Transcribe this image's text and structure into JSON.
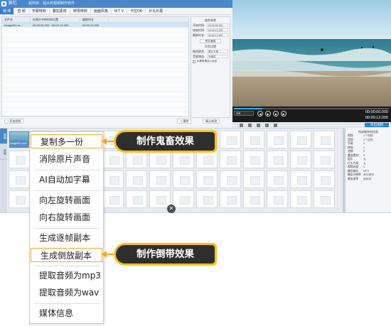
{
  "app": {
    "name": "影忆",
    "slogan": "超简单、强大的视频制作软件"
  },
  "menu": {
    "items": [
      "视 频",
      "音 频",
      "字幕特效",
      "叠加素材",
      "转场特效",
      "画面风格",
      "M T V",
      "卡拉OK",
      "片头片尾"
    ],
    "active_index": 0
  },
  "file_list": {
    "columns": [
      "文件名",
      "在原片中的时间位置",
      "截取时长"
    ],
    "rows": [
      [
        "image001.m...",
        "00:00:00.000 - 00:00:12.000",
        "00:00:12.000"
      ]
    ],
    "add_button": "添加视频",
    "delete_button": "删除",
    "confirm_button": "确认修改"
  },
  "settings": {
    "section1_title": "裁剪参数",
    "section2_title": "声音设置",
    "fields": [
      {
        "label": "开始时间:",
        "value": "00:00:00.000"
      },
      {
        "label": "结束时间:",
        "value": "00:00:12.000"
      },
      {
        "label": "截取时长:",
        "value": "00:00:12.000"
      }
    ],
    "pick_button": "预览/截取",
    "sound_fields": [
      {
        "label": "使用原音:",
        "value": "原片无损"
      },
      {
        "label": "音量增益:",
        "value": "不增益"
      }
    ],
    "checkbox_label": "头尾声音淡入淡出"
  },
  "player": {
    "spin_value": "1/4",
    "time_current": "00:00:00.000",
    "time_total": "00:00:12.000",
    "export_label": "导出视频"
  },
  "timeline": {
    "tab_labels": [
      "视频",
      "音频"
    ],
    "first_clip_name": "image001.mp4",
    "close_glyph": "✕"
  },
  "right_panel": {
    "title": "所选制作的信息",
    "rows": [
      {
        "k": "视频",
        "v": "1个视频"
      },
      {
        "k": "音频",
        "v": "0个音频"
      },
      {
        "k": "字幕",
        "v": "0"
      },
      {
        "k": "转场",
        "v": "0"
      },
      {
        "k": "滤镜",
        "v": "0"
      },
      {
        "k": "叠加素材",
        "v": "0"
      },
      {
        "k": "配乐",
        "v": "无"
      },
      {
        "k": "片头片尾",
        "v": "无"
      },
      {
        "k": "视频长度",
        "v": "0"
      },
      {
        "k": "输出格式",
        "v": "MP4"
      },
      {
        "k": "输出分辨率",
        "v": "原分辨率"
      },
      {
        "k": "输出帧率",
        "v": "原帧率"
      }
    ]
  },
  "context_menu": {
    "items": [
      "复制多一份",
      "消除原片声音",
      "AI自动加字幕",
      "向左旋转画面",
      "向右旋转画面",
      "生成逐帧副本",
      "生成倒放副本",
      "提取音频为mp3",
      "提取音频为wav",
      "媒体信息"
    ],
    "highlighted": [
      0,
      6
    ]
  },
  "callouts": {
    "first": "制作鬼畜效果",
    "second": "制作倒带效果"
  },
  "colors": {
    "accent": "#f5a623",
    "callout_bg": "#2e2e2e",
    "title_blue": "#4a87c9"
  }
}
